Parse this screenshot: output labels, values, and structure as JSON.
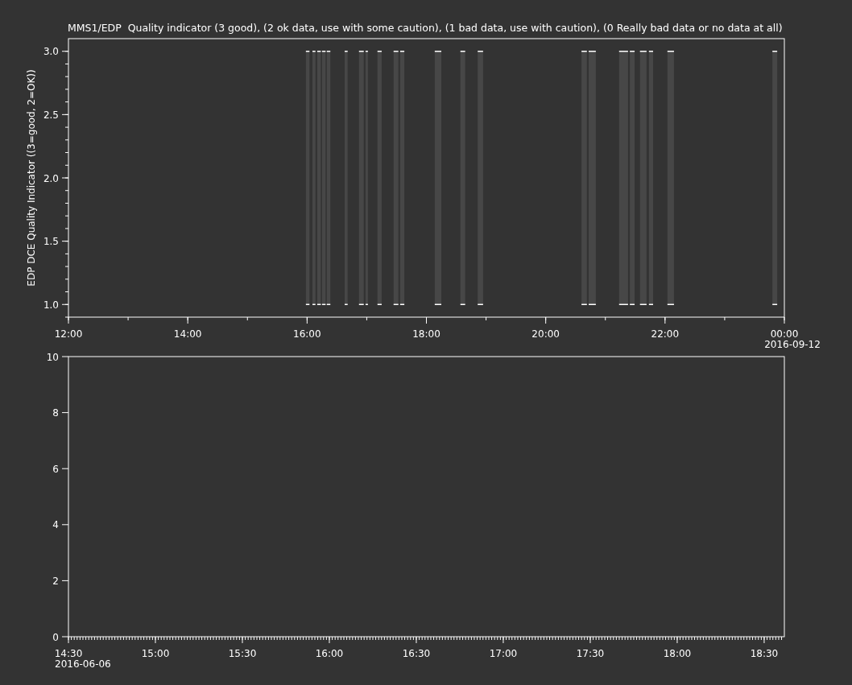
{
  "plots": [
    {
      "title": "MMS1/EDP  Quality indicator (3 good), (2 ok data, use with some caution), (1 bad data, use with caution), (0 Really bad data or no data at all)",
      "date_label": "2016-09-12",
      "chart_data": {
        "type": "area",
        "ylabel": "EDP DCE Quality Indicator ((3=good, 2=OK))",
        "xlim": [
          12,
          24
        ],
        "ylim": [
          0.9,
          3.1
        ],
        "xticks": [
          {
            "value": 12,
            "label": "12:00"
          },
          {
            "value": 14,
            "label": "14:00"
          },
          {
            "value": 16,
            "label": "16:00"
          },
          {
            "value": 18,
            "label": "18:00"
          },
          {
            "value": 20,
            "label": "20:00"
          },
          {
            "value": 22,
            "label": "22:00"
          },
          {
            "value": 24,
            "label": "00:00"
          }
        ],
        "yticks": [
          {
            "value": 1,
            "label": "1.0"
          },
          {
            "value": 1.5,
            "label": "1.5"
          },
          {
            "value": 2,
            "label": "2.0"
          },
          {
            "value": 2.5,
            "label": "2.5"
          },
          {
            "value": 3,
            "label": "3.0"
          }
        ],
        "x": [
          15.98,
          16.04,
          16.06,
          16.09,
          16.14,
          16.15,
          16.17,
          16.23,
          16.24,
          16.25,
          16.31,
          16.32,
          16.33,
          16.39,
          16.5,
          16.63,
          16.68,
          16.8,
          16.87,
          16.95,
          16.96,
          16.98,
          17.02,
          17.1,
          17.18,
          17.25,
          17.35,
          17.45,
          17.53,
          17.54,
          17.56,
          17.63,
          17.9,
          18.14,
          18.25,
          18.4,
          18.57,
          18.65,
          18.75,
          18.86,
          18.95,
          19.8,
          20.6,
          20.69,
          20.7,
          20.72,
          20.84,
          21.0,
          21.23,
          21.38,
          21.39,
          21.41,
          21.49,
          21.53,
          21.58,
          21.69,
          21.71,
          21.73,
          21.8,
          21.9,
          22.04,
          22.15,
          23.0,
          23.8,
          23.88
        ],
        "series": [
          {
            "color": "#474747",
            "values": [
              3,
              3,
              null,
              3,
              3,
              null,
              3,
              3,
              null,
              3,
              3,
              null,
              3,
              3,
              null,
              3,
              3,
              null,
              3,
              3,
              null,
              3,
              3,
              null,
              3,
              3,
              null,
              3,
              3,
              null,
              3,
              3,
              null,
              3,
              3,
              null,
              3,
              3,
              null,
              3,
              3,
              null,
              3,
              3,
              null,
              3,
              3,
              null,
              3,
              3,
              null,
              3,
              3,
              null,
              3,
              3,
              null,
              3,
              3,
              null,
              3,
              3,
              null,
              3,
              3
            ]
          }
        ]
      }
    },
    {
      "date_label": "2016-06-06",
      "chart_data": {
        "type": "line",
        "xlim": [
          14.5,
          18.616
        ],
        "ylim": [
          0,
          10
        ],
        "xticks": [
          {
            "value": 14.5,
            "label": "14:30"
          },
          {
            "value": 15,
            "label": "15:00"
          },
          {
            "value": 15.5,
            "label": "15:30"
          },
          {
            "value": 16,
            "label": "16:00"
          },
          {
            "value": 16.5,
            "label": "16:30"
          },
          {
            "value": 17,
            "label": "17:00"
          },
          {
            "value": 17.5,
            "label": "17:30"
          },
          {
            "value": 18,
            "label": "18:00"
          },
          {
            "value": 18.5,
            "label": "18:30"
          }
        ],
        "yticks": [
          0,
          2,
          4,
          6,
          8,
          10
        ]
      }
    }
  ]
}
